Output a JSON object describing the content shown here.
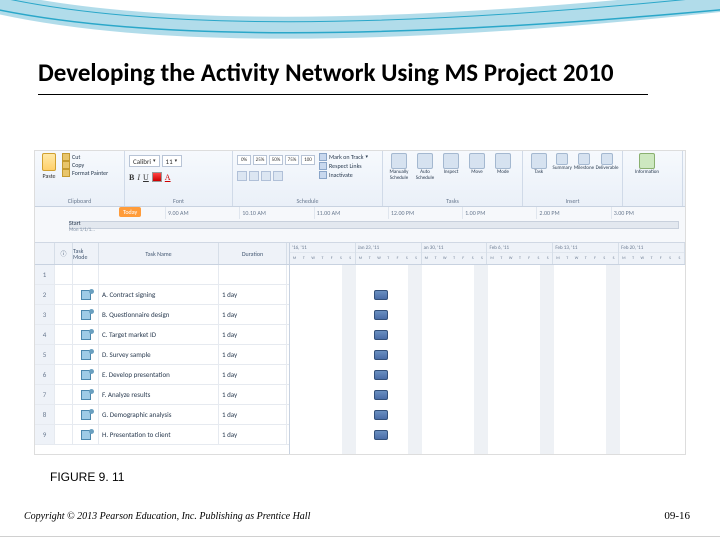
{
  "slide": {
    "title": "Developing the Activity Network Using MS Project 2010",
    "figure_label": "FIGURE 9. 11",
    "copyright": "Copyright © 2013 Pearson Education, Inc. Publishing as Prentice Hall",
    "slide_number": "09-16"
  },
  "ribbon": {
    "clipboard": {
      "paste": "Paste",
      "cut": "Cut",
      "copy": "Copy",
      "format_painter": "Format Painter",
      "label": "Clipboard"
    },
    "font": {
      "name": "Calibri",
      "size": "11",
      "label": "Font"
    },
    "schedule": {
      "pcts": [
        "0%",
        "25%",
        "50%",
        "75%",
        "100"
      ],
      "mark_on_track": "Mark on Track",
      "respect_links": "Respect Links",
      "inactivate": "Inactivate",
      "label": "Schedule"
    },
    "tasks": {
      "manual": "Manually Schedule",
      "auto": "Auto Schedule",
      "inspect": "Inspect",
      "move": "Move",
      "mode": "Mode",
      "label": "Tasks"
    },
    "insert": {
      "task": "Task",
      "summary": "Summary",
      "milestone": "Milestone",
      "deliverable": "Deliverable",
      "label": "Insert"
    },
    "info": {
      "information": "Information"
    }
  },
  "timeline": {
    "today": "Today",
    "start": "Start",
    "start_date": "Mon 1/1/1...",
    "ticks": [
      "9.00 AM",
      "10.10 AM",
      "11.00 AM",
      "12.00 PM",
      "1.00 PM",
      "2.00 PM",
      "3.00 PM"
    ]
  },
  "table": {
    "headers": {
      "info": "ⓘ",
      "mode": "Task Mode",
      "name": "Task Name",
      "duration": "Duration"
    },
    "weeks": [
      "'16, '11",
      "Jan 23, '11",
      "an 30, '11",
      "Feb 6, '11",
      "Feb 13, '11",
      "Feb 20, '11"
    ],
    "day_letters": [
      "M",
      "T",
      "W",
      "T",
      "F",
      "S",
      "S"
    ],
    "rows": [
      {
        "num": "1",
        "name": "",
        "duration": ""
      },
      {
        "num": "2",
        "name": "A. Contract signing",
        "duration": "1 day",
        "bar_week": 2,
        "bar_day": 0
      },
      {
        "num": "3",
        "name": "B. Questionnaire design",
        "duration": "1 day",
        "bar_week": 2,
        "bar_day": 0
      },
      {
        "num": "4",
        "name": "C. Target market ID",
        "duration": "1 day",
        "bar_week": 2,
        "bar_day": 0
      },
      {
        "num": "5",
        "name": "D. Survey sample",
        "duration": "1 day",
        "bar_week": 2,
        "bar_day": 0
      },
      {
        "num": "6",
        "name": "E. Develop presentation",
        "duration": "1 day",
        "bar_week": 2,
        "bar_day": 0
      },
      {
        "num": "7",
        "name": "F. Analyze results",
        "duration": "1 day",
        "bar_week": 2,
        "bar_day": 0
      },
      {
        "num": "8",
        "name": "G. Demographic analysis",
        "duration": "1 day",
        "bar_week": 2,
        "bar_day": 0
      },
      {
        "num": "9",
        "name": "H. Presentation to client",
        "duration": "1 day",
        "bar_week": 2,
        "bar_day": 0
      }
    ]
  }
}
